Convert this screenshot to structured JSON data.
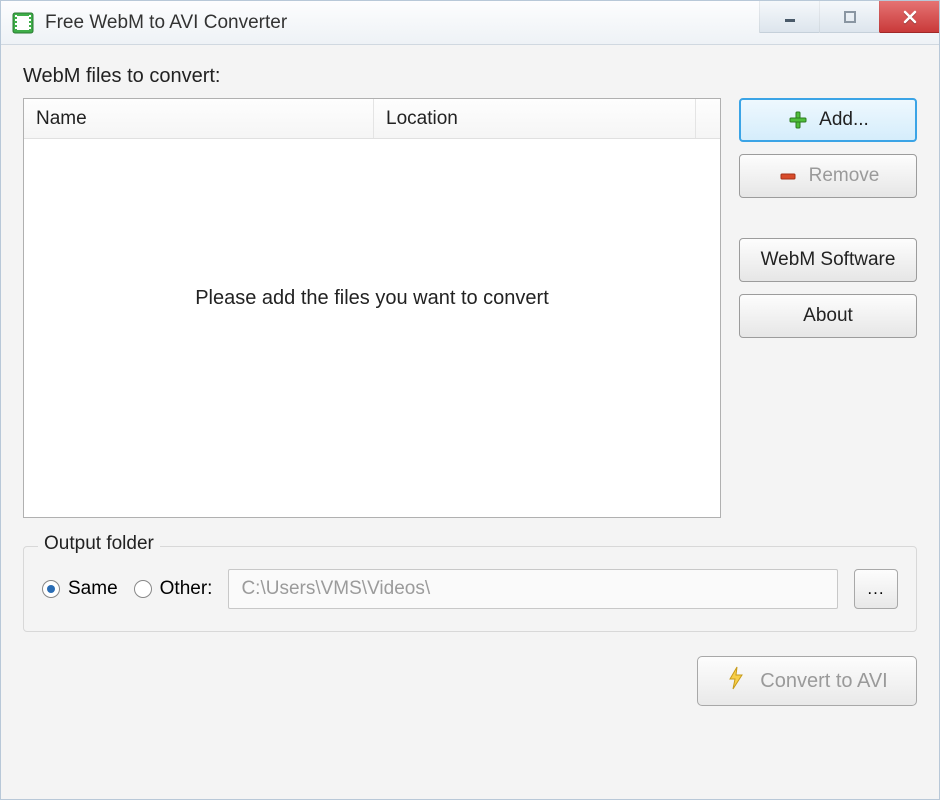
{
  "titlebar": {
    "title": "Free WebM to AVI Converter"
  },
  "main": {
    "files_label": "WebM files to convert:",
    "columns": {
      "name": "Name",
      "location": "Location"
    },
    "placeholder": "Please add the files you want to convert"
  },
  "side": {
    "add": "Add...",
    "remove": "Remove",
    "webm_software": "WebM Software",
    "about": "About"
  },
  "output": {
    "legend": "Output folder",
    "same": "Same",
    "other": "Other:",
    "path": "C:\\Users\\VMS\\Videos\\",
    "browse": "..."
  },
  "footer": {
    "convert": "Convert to AVI"
  }
}
